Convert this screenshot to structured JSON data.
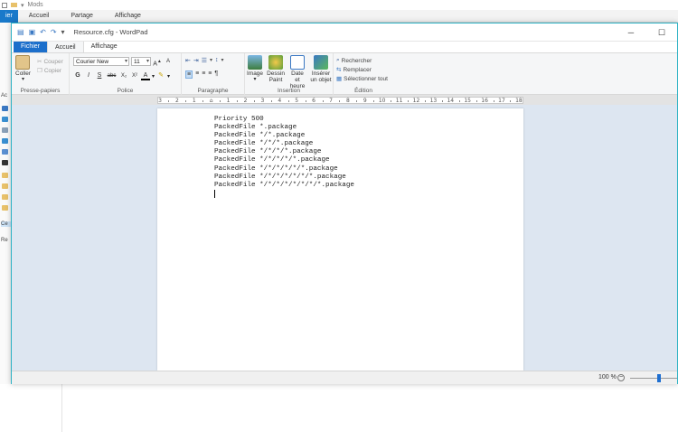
{
  "background_window": {
    "title": "Mods",
    "tabs": [
      {
        "label": "ier"
      },
      {
        "label": "Accueil"
      },
      {
        "label": "Partage"
      },
      {
        "label": "Affichage"
      }
    ],
    "nav_fragments": [
      "Ac",
      "Ce",
      "Re"
    ],
    "icon_colors": [
      "#3a78c3",
      "#e8b33a",
      "#3a8fd1",
      "#333333",
      "#7d5ccf",
      "#e8c16a"
    ]
  },
  "wordpad": {
    "title": "Resource.cfg - WordPad",
    "tabs": {
      "file": "Fichier",
      "home": "Accueil",
      "view": "Affichage"
    },
    "clipboard": {
      "paste": "Coller",
      "cut": "Couper",
      "copy": "Copier",
      "group": "Presse-papiers"
    },
    "font": {
      "family": "Courier New",
      "size": "11",
      "group": "Police",
      "bold": "G",
      "italic": "I",
      "underline": "S",
      "strike": "abc",
      "color_letter": "A"
    },
    "paragraph": {
      "group": "Paragraphe"
    },
    "insert": {
      "image": "Image",
      "paint": "Dessin Paint",
      "datetime": "Date et heure",
      "object": "Insérer un objet",
      "group": "Insertion"
    },
    "edit": {
      "find": "Rechercher",
      "replace": "Remplacer",
      "select_all": "Sélectionner tout",
      "group": "Édition"
    },
    "ruler_labels": [
      "3",
      "2",
      "1",
      "",
      "1",
      "2",
      "3",
      "4",
      "5",
      "6",
      "7",
      "8",
      "9",
      "10",
      "11",
      "12",
      "13",
      "14",
      "15",
      "16",
      "17",
      "18"
    ],
    "document_lines": [
      "Priority 500",
      "PackedFile *.package",
      "PackedFile */*.package",
      "PackedFile */*/*.package",
      "PackedFile */*/*/*.package",
      "PackedFile */*/*/*/*.package",
      "PackedFile */*/*/*/*/*.package",
      "PackedFile */*/*/*/*/*/*.package",
      "PackedFile */*/*/*/*/*/*/*.package"
    ],
    "status": {
      "zoom": "100 %",
      "zoom_minus": "−",
      "zoom_level_percent": 100
    },
    "accent_color": "#1c6fcb"
  }
}
